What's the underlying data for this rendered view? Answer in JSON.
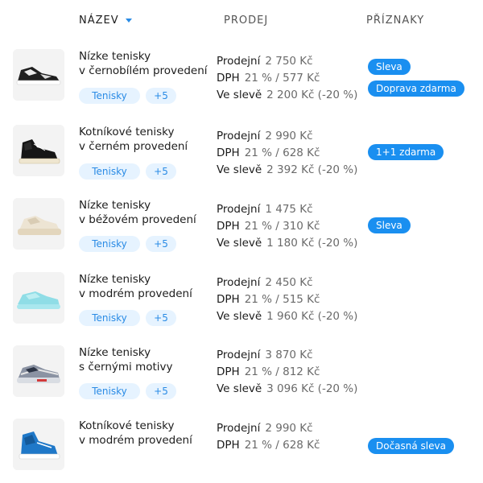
{
  "header": {
    "name": "NÁZEV",
    "sales": "PRODEJ",
    "flags": "PŘÍZNAKY"
  },
  "labels": {
    "price": "Prodejní",
    "vat": "DPH",
    "discount": "Ve slevě"
  },
  "products": [
    {
      "name_line1": "Nízke tenisky",
      "name_line2": "v černobílém provedení",
      "category": "Tenisky",
      "more": "+5",
      "price": "2 750 Kč",
      "vat": "21 % / 577 Kč",
      "discount": "2 200 Kč (-20 %)",
      "flags": [
        "Sleva",
        "Doprava zdarma"
      ]
    },
    {
      "name_line1": "Kotníkové tenisky",
      "name_line2": "v černém provedení",
      "category": "Tenisky",
      "more": "+5",
      "price": "2 990 Kč",
      "vat": "21 % / 628 Kč",
      "discount": "2 392 Kč (-20 %)",
      "flags": [
        "1+1 zdarma"
      ]
    },
    {
      "name_line1": "Nízke tenisky",
      "name_line2": "v béžovém provedení",
      "category": "Tenisky",
      "more": "+5",
      "price": "1 475 Kč",
      "vat": "21 % / 310 Kč",
      "discount": "1 180 Kč (-20 %)",
      "flags": [
        "Sleva"
      ]
    },
    {
      "name_line1": "Nízke tenisky",
      "name_line2": "v modrém provedení",
      "category": "Tenisky",
      "more": "+5",
      "price": "2 450 Kč",
      "vat": "21 % / 515 Kč",
      "discount": "1 960 Kč (-20 %)",
      "flags": []
    },
    {
      "name_line1": "Nízke tenisky",
      "name_line2": "s černými motivy",
      "category": "Tenisky",
      "more": "+5",
      "price": "3 870 Kč",
      "vat": "21 % / 812 Kč",
      "discount": "3 096 Kč (-20 %)",
      "flags": []
    },
    {
      "name_line1": "Kotníkové tenisky",
      "name_line2": "v modrém provedení",
      "price": "2 990 Kč",
      "vat": "21 % / 628 Kč",
      "flags": [
        "Dočasná sleva"
      ]
    }
  ],
  "colors": {
    "accent": "#1a8ff0",
    "chip_bg": "#e6f3ff",
    "chip_text": "#2a8be5"
  }
}
